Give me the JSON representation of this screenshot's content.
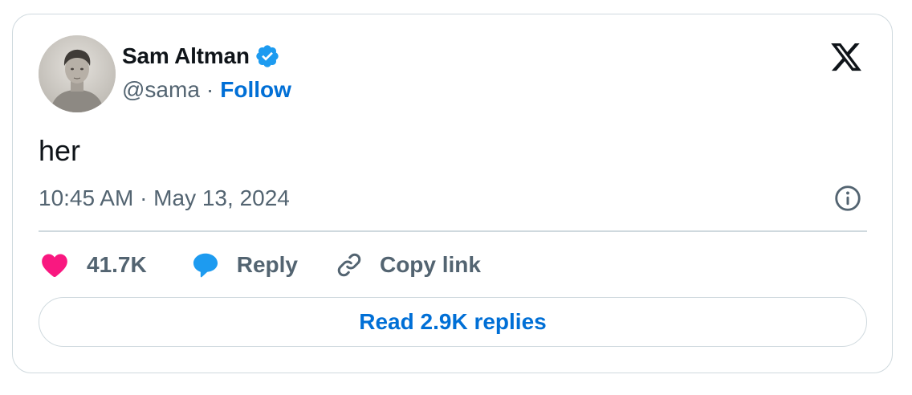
{
  "author": {
    "name": "Sam Altman",
    "handle": "@sama",
    "separator": "·",
    "follow_label": "Follow",
    "verified": true
  },
  "tweet": {
    "text": "her",
    "timestamp": "10:45 AM · May 13, 2024"
  },
  "actions": {
    "likes": "41.7K",
    "reply_label": "Reply",
    "copy_link_label": "Copy link"
  },
  "read_replies_label": "Read 2.9K replies",
  "icons": {
    "brand": "x-logo-icon",
    "verified": "verified-badge-icon",
    "info": "info-icon",
    "like": "heart-icon",
    "reply": "speech-bubble-icon",
    "copy": "link-icon"
  },
  "colors": {
    "link_blue": "#006fd6",
    "verified_blue": "#1d9bf0",
    "heart_pink": "#f91880",
    "muted": "#536471",
    "border": "#cfd9de"
  }
}
